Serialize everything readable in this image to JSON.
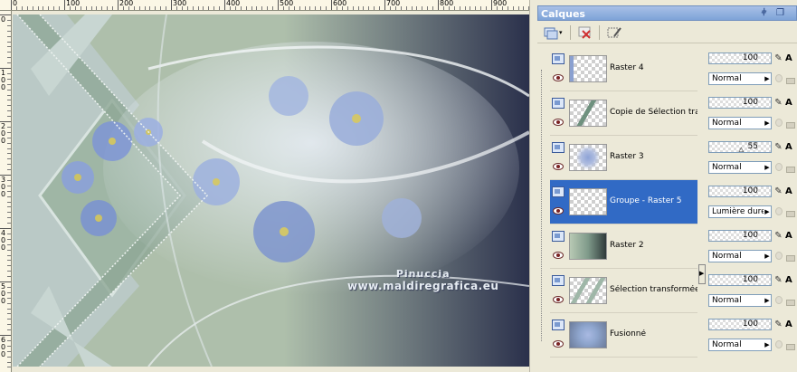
{
  "ruler": {
    "top_labels": [
      "0",
      "100",
      "200",
      "300",
      "400",
      "500",
      "600",
      "700",
      "800",
      "900"
    ],
    "left_labels": [
      "0",
      "1\n0\n0",
      "2\n0\n0",
      "3\n0\n0",
      "4\n0\n0",
      "5\n0\n0",
      "6\n0\n0"
    ]
  },
  "watermark": {
    "name": "Pinuccia",
    "url": "www.maldiregrafica.eu"
  },
  "palette": {
    "title": "Calques",
    "title_pin_icon": "pin-icon",
    "title_restore_icon": "restore-icon",
    "toolbar_icons": [
      "new-layer-icon",
      "dropdown-arrow-icon",
      "delete-layer-icon",
      "edit-selection-icon"
    ],
    "layers": [
      {
        "name": "Raster 4",
        "opacity": "100",
        "blend": "Normal",
        "flag": "A",
        "selected": false
      },
      {
        "name": "Copie de Sélection tran",
        "opacity": "100",
        "blend": "Normal",
        "flag": "A",
        "selected": false
      },
      {
        "name": "Raster 3",
        "opacity": "55",
        "blend": "Normal",
        "flag": "A",
        "selected": false
      },
      {
        "name": "Groupe - Raster 5",
        "opacity": "100",
        "blend": "Lumière dure",
        "flag": "A",
        "selected": true
      },
      {
        "name": "Raster 2",
        "opacity": "100",
        "blend": "Normal",
        "flag": "A",
        "selected": false
      },
      {
        "name": "Sélection transformée",
        "opacity": "100",
        "blend": "Normal",
        "flag": "A",
        "selected": false
      },
      {
        "name": "Fusionné",
        "opacity": "100",
        "blend": "Normal",
        "flag": "A",
        "selected": false
      }
    ]
  },
  "colors": {
    "selection_blue": "#316ac5",
    "title_blue": "#7ea3d8",
    "window_bg": "#ece9d8"
  }
}
